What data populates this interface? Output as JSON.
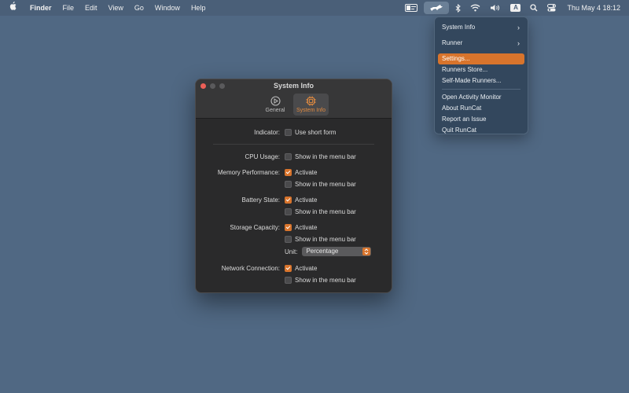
{
  "menubar": {
    "app_name": "Finder",
    "menus": [
      "File",
      "Edit",
      "View",
      "Go",
      "Window",
      "Help"
    ],
    "input_source": "A",
    "clock": "Thu May 4  18:12"
  },
  "dropdown": {
    "items": [
      {
        "label": "System Info",
        "submenu": true
      },
      {
        "label": "Runner",
        "submenu": true
      },
      {
        "label": "Settings...",
        "highlighted": true
      },
      {
        "label": "Runners Store..."
      },
      {
        "label": "Self-Made Runners..."
      },
      {
        "label": "Open Activity Monitor"
      },
      {
        "label": "About RunCat"
      },
      {
        "label": "Report an Issue"
      },
      {
        "label": "Quit RunCat"
      }
    ]
  },
  "window": {
    "title": "System Info",
    "tabs": [
      {
        "label": "General",
        "active": false
      },
      {
        "label": "System Info",
        "active": true
      }
    ],
    "rows": {
      "indicator": {
        "label": "Indicator:",
        "option": "Use short form",
        "checked": false
      },
      "cpu": {
        "label": "CPU Usage:",
        "option": "Show in the menu bar",
        "checked": false
      },
      "memory": {
        "label": "Memory Performance:",
        "activate": "Activate",
        "activate_checked": true,
        "menubar": "Show in the menu bar",
        "menubar_checked": false
      },
      "battery": {
        "label": "Battery State:",
        "activate": "Activate",
        "activate_checked": true,
        "menubar": "Show in the menu bar",
        "menubar_checked": false
      },
      "storage": {
        "label": "Storage Capacity:",
        "activate": "Activate",
        "activate_checked": true,
        "menubar": "Show in the menu bar",
        "menubar_checked": false,
        "unit_label": "Unit:",
        "unit_value": "Percentage"
      },
      "network": {
        "label": "Network Connection:",
        "activate": "Activate",
        "activate_checked": true,
        "menubar": "Show in the menu bar",
        "menubar_checked": false
      }
    }
  },
  "colors": {
    "desktop": "#506883",
    "accent": "#d8742c",
    "menu_bg": "#33475d",
    "window_bg": "#2a2a2b"
  }
}
